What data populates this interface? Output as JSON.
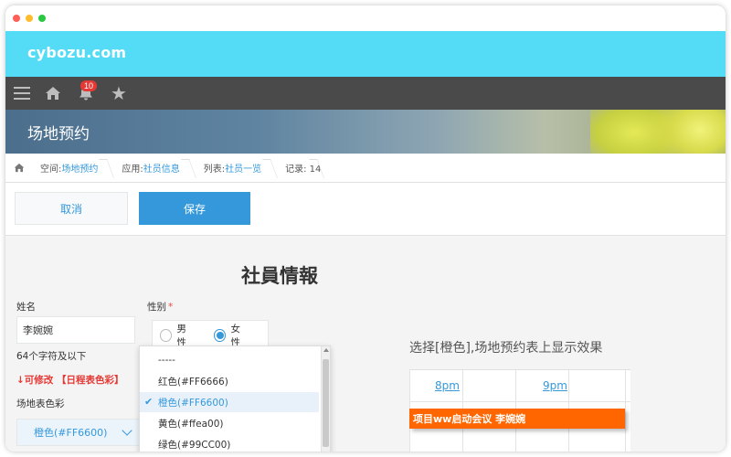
{
  "brand": {
    "name": "cybozu.com"
  },
  "nav": {
    "notification_count": "10"
  },
  "banner": {
    "title": "场地预约"
  },
  "breadcrumb": {
    "space_label": "空间:",
    "space_value": "场地预约",
    "app_label": "应用:",
    "app_value": "社员信息",
    "list_label": "列表:",
    "list_value": "社员一览",
    "record_label": "记录: 14"
  },
  "toolbar": {
    "cancel_label": "取消",
    "save_label": "保存"
  },
  "form": {
    "title": "社員情報",
    "name_label": "姓名",
    "name_value": "李婉婉",
    "name_hint": "64个字符及以下",
    "editable_note": "↓可修改 【日程表色彩】",
    "color_label": "场地表色彩",
    "color_value": "橙色(#FF6600)",
    "gender_label": "性别",
    "gender_required": "*",
    "gender_options": [
      "男性",
      "女性"
    ],
    "gender_selected": "女性"
  },
  "dropdown": {
    "items": [
      "-----",
      "红色(#FF6666)",
      "橙色(#FF6600)",
      "黄色(#ffea00)",
      "绿色(#99CC00)"
    ],
    "selected": "橙色(#FF6600)"
  },
  "preview": {
    "description": "选择[橙色],场地预约表上显示效果",
    "times": [
      "8pm",
      "9pm"
    ],
    "event_text": "项目ww启动会议 李婉婉",
    "event_color": "#FF6600"
  },
  "colors": {
    "brand_bar": "#54DCF7",
    "nav_bar": "#4A4A4A",
    "accent": "#3498DB",
    "event": "#FF6600"
  }
}
